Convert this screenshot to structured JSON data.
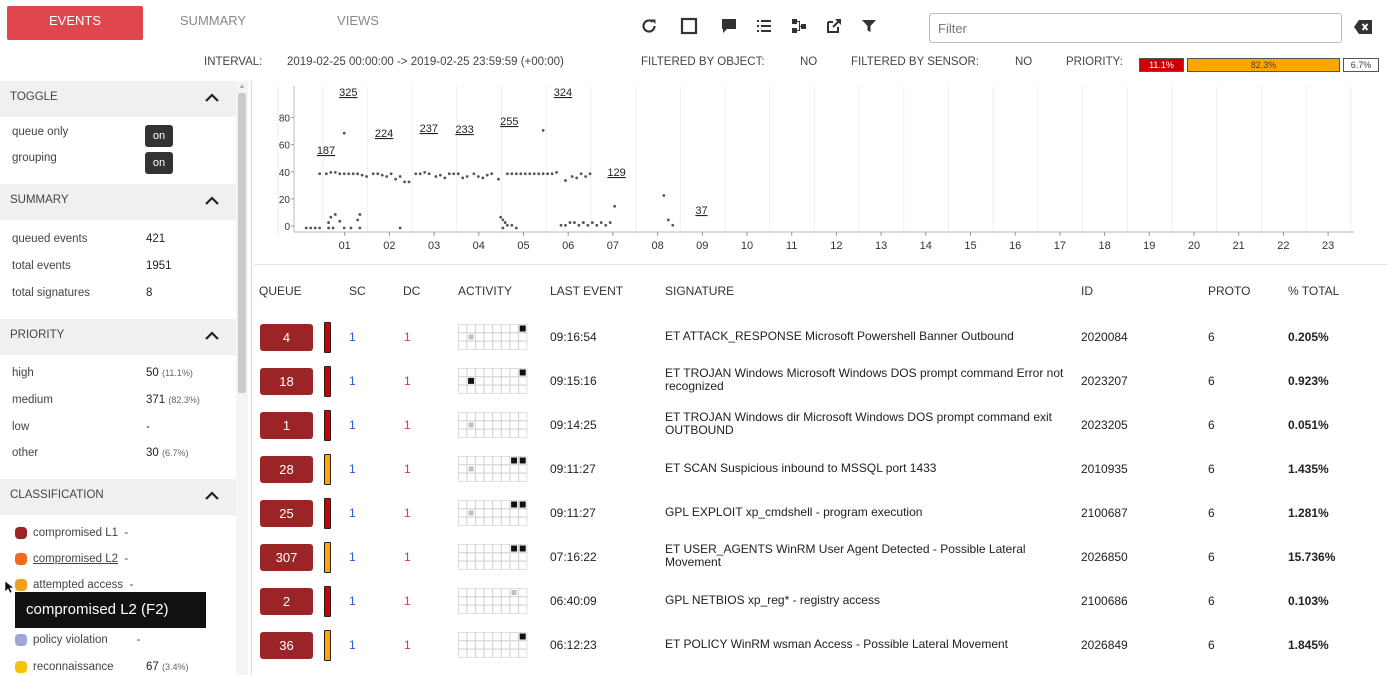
{
  "tabs": [
    {
      "label": "EVENTS",
      "active": true
    },
    {
      "label": "SUMMARY",
      "active": false
    },
    {
      "label": "VIEWS",
      "active": false
    }
  ],
  "toolbar_icons": [
    "refresh-icon",
    "fullscreen-icon",
    "comment-icon",
    "list-icon",
    "graph-icon",
    "external-link-icon",
    "filter-icon"
  ],
  "filter": {
    "placeholder": "Filter",
    "value": ""
  },
  "info": {
    "interval_label": "INTERVAL:",
    "interval_value": "2019-02-25 00:00:00 -> 2019-02-25 23:59:59 (+00:00)",
    "by_object_label": "FILTERED BY OBJECT:",
    "by_object_value": "NO",
    "by_sensor_label": "FILTERED BY SENSOR:",
    "by_sensor_value": "NO",
    "priority_label": "PRIORITY:",
    "priority_bars": [
      {
        "label": "11.1%",
        "fraction": 0.111,
        "color": "#cc0000"
      },
      {
        "label": "82.3%",
        "fraction": 0.823,
        "color": "#ffa500"
      },
      {
        "label": "6.7%",
        "fraction": 0.067,
        "color": "#ffffff"
      }
    ]
  },
  "sidebar": {
    "toggle": {
      "title": "TOGGLE",
      "items": [
        {
          "label": "queue only",
          "state": "on"
        },
        {
          "label": "grouping",
          "state": "on"
        }
      ]
    },
    "summary": {
      "title": "SUMMARY",
      "items": [
        {
          "label": "queued events",
          "value": "421"
        },
        {
          "label": "total events",
          "value": "1951"
        },
        {
          "label": "total signatures",
          "value": "8"
        }
      ]
    },
    "priority": {
      "title": "PRIORITY",
      "items": [
        {
          "label": "high",
          "value": "50",
          "pct": "(11.1%)"
        },
        {
          "label": "medium",
          "value": "371",
          "pct": "(82.3%)"
        },
        {
          "label": "low",
          "value": "-",
          "pct": ""
        },
        {
          "label": "other",
          "value": "30",
          "pct": "(6.7%)"
        }
      ]
    },
    "classification": {
      "title": "CLASSIFICATION",
      "items": [
        {
          "label": "compromised L1",
          "value": "-",
          "color": "#9b2426",
          "link": false
        },
        {
          "label": "compromised L2",
          "value": "-",
          "color": "#f26a1b",
          "link": true
        },
        {
          "label": "attempted access",
          "value": "-",
          "color": "#f2a01b",
          "link": false
        },
        {
          "label": "policy violation",
          "value": "-",
          "color": "#9ea8d8",
          "link": false
        },
        {
          "label": "reconnaissance",
          "value": "67",
          "pct": "(3.4%)",
          "color": "#f5c400",
          "link": false
        }
      ]
    },
    "tooltip": "compromised L2 (F2)"
  },
  "chart_data": {
    "type": "scatter",
    "x_ticks": [
      "01",
      "02",
      "03",
      "04",
      "05",
      "06",
      "07",
      "08",
      "09",
      "10",
      "11",
      "12",
      "13",
      "14",
      "15",
      "16",
      "17",
      "18",
      "19",
      "20",
      "21",
      "22",
      "23"
    ],
    "y_ticks": [
      "0",
      "20",
      "40",
      "60",
      "80"
    ],
    "ylim": [
      0,
      90
    ],
    "hour_totals": [
      {
        "hour": 0,
        "label": "187"
      },
      {
        "hour": 0.5,
        "label": "325"
      },
      {
        "hour": 1.3,
        "label": "224"
      },
      {
        "hour": 2.3,
        "label": "237"
      },
      {
        "hour": 3.1,
        "label": "233"
      },
      {
        "hour": 4.1,
        "label": "255"
      },
      {
        "hour": 5.3,
        "label": "324"
      },
      {
        "hour": 6.5,
        "label": "129"
      },
      {
        "hour": 8.4,
        "label": "37"
      }
    ],
    "points": [
      [
        0.05,
        0
      ],
      [
        0.15,
        0
      ],
      [
        0.25,
        0
      ],
      [
        0.35,
        0
      ],
      [
        0.55,
        0
      ],
      [
        0.65,
        0
      ],
      [
        0.9,
        0
      ],
      [
        1.05,
        0
      ],
      [
        1.25,
        0
      ],
      [
        2.15,
        0
      ],
      [
        4.45,
        0
      ],
      [
        4.75,
        0
      ],
      [
        0.35,
        40
      ],
      [
        0.5,
        40
      ],
      [
        0.6,
        41
      ],
      [
        0.7,
        41
      ],
      [
        0.8,
        40
      ],
      [
        0.9,
        40
      ],
      [
        1.0,
        40
      ],
      [
        1.1,
        40
      ],
      [
        1.2,
        40
      ],
      [
        1.3,
        39
      ],
      [
        1.4,
        38
      ],
      [
        1.55,
        40
      ],
      [
        1.65,
        40
      ],
      [
        1.75,
        39
      ],
      [
        1.85,
        38
      ],
      [
        1.95,
        40
      ],
      [
        2.05,
        36
      ],
      [
        2.15,
        38
      ],
      [
        2.25,
        34
      ],
      [
        2.35,
        34
      ],
      [
        2.5,
        40
      ],
      [
        2.6,
        40
      ],
      [
        2.7,
        41
      ],
      [
        2.8,
        40
      ],
      [
        2.95,
        38
      ],
      [
        3.05,
        39
      ],
      [
        3.15,
        37
      ],
      [
        3.25,
        40
      ],
      [
        3.35,
        40
      ],
      [
        3.45,
        40
      ],
      [
        3.55,
        37
      ],
      [
        3.65,
        38
      ],
      [
        3.8,
        40
      ],
      [
        3.9,
        38
      ],
      [
        4.0,
        37
      ],
      [
        4.1,
        39
      ],
      [
        4.2,
        40
      ],
      [
        4.35,
        36
      ],
      [
        4.55,
        40
      ],
      [
        4.65,
        40
      ],
      [
        4.75,
        40
      ],
      [
        4.85,
        40
      ],
      [
        4.95,
        40
      ],
      [
        5.05,
        40
      ],
      [
        5.15,
        40
      ],
      [
        5.25,
        40
      ],
      [
        5.35,
        40
      ],
      [
        5.45,
        40
      ],
      [
        5.55,
        40
      ],
      [
        5.65,
        41
      ],
      [
        5.85,
        35
      ],
      [
        6.0,
        38
      ],
      [
        6.1,
        37
      ],
      [
        6.2,
        40
      ],
      [
        6.3,
        38
      ],
      [
        6.4,
        40
      ],
      [
        0.9,
        70
      ],
      [
        5.35,
        72
      ],
      [
        0.55,
        4
      ],
      [
        0.6,
        8
      ],
      [
        0.7,
        10
      ],
      [
        0.8,
        5
      ],
      [
        1.2,
        6
      ],
      [
        1.25,
        10
      ],
      [
        4.4,
        8
      ],
      [
        4.45,
        6
      ],
      [
        4.5,
        4
      ],
      [
        4.55,
        2
      ],
      [
        4.65,
        2
      ],
      [
        5.75,
        2
      ],
      [
        5.85,
        2
      ],
      [
        5.95,
        4
      ],
      [
        6.05,
        4
      ],
      [
        6.15,
        2
      ],
      [
        6.25,
        4
      ],
      [
        6.35,
        2
      ],
      [
        6.45,
        4
      ],
      [
        6.55,
        2
      ],
      [
        6.65,
        4
      ],
      [
        6.75,
        2
      ],
      [
        6.85,
        4
      ],
      [
        6.95,
        16
      ],
      [
        8.05,
        24
      ],
      [
        8.15,
        6
      ],
      [
        8.25,
        2
      ]
    ]
  },
  "table": {
    "headers": [
      "QUEUE",
      "SC",
      "DC",
      "ACTIVITY",
      "LAST EVENT",
      "SIGNATURE",
      "ID",
      "PROTO",
      "% TOTAL"
    ],
    "rows": [
      {
        "queue": "4",
        "prio": "#cc0000",
        "sc": "1",
        "dc": "1",
        "activity": {
          "light": [
            8
          ],
          "dark": [
            3
          ]
        },
        "last": "09:16:54",
        "sig": "ET ATTACK_RESPONSE Microsoft Powershell Banner Outbound",
        "id": "2020084",
        "proto": "6",
        "pct": "0.205%"
      },
      {
        "queue": "18",
        "prio": "#cc0000",
        "sc": "1",
        "dc": "1",
        "activity": {
          "light": [],
          "dark": [
            8,
            3
          ]
        },
        "last": "09:15:16",
        "sig": "ET TROJAN Windows Microsoft Windows DOS prompt command Error not recognized",
        "id": "2023207",
        "proto": "6",
        "pct": "0.923%"
      },
      {
        "queue": "1",
        "prio": "#cc0000",
        "sc": "1",
        "dc": "1",
        "activity": {
          "light": [
            8
          ],
          "dark": []
        },
        "last": "09:14:25",
        "sig": "ET TROJAN Windows dir Microsoft Windows DOS prompt command exit OUTBOUND",
        "id": "2023205",
        "proto": "6",
        "pct": "0.051%"
      },
      {
        "queue": "28",
        "prio": "#ffa500",
        "sc": "1",
        "dc": "1",
        "activity": {
          "light": [
            8
          ],
          "dark": [
            2,
            3
          ]
        },
        "last": "09:11:27",
        "sig": "ET SCAN Suspicious inbound to MSSQL port 1433",
        "id": "2010935",
        "proto": "6",
        "pct": "1.435%"
      },
      {
        "queue": "25",
        "prio": "#cc0000",
        "sc": "1",
        "dc": "1",
        "activity": {
          "light": [
            8
          ],
          "dark": [
            2,
            3
          ]
        },
        "last": "09:11:27",
        "sig": "GPL EXPLOIT xp_cmdshell - program execution",
        "id": "2100687",
        "proto": "6",
        "pct": "1.281%"
      },
      {
        "queue": "307",
        "prio": "#ffa500",
        "sc": "1",
        "dc": "1",
        "activity": {
          "light": [],
          "dark": [
            2,
            3
          ]
        },
        "last": "07:16:22",
        "sig": "ET USER_AGENTS WinRM User Agent Detected - Possible Lateral Movement",
        "id": "2026850",
        "proto": "6",
        "pct": "15.736%"
      },
      {
        "queue": "2",
        "prio": "#cc0000",
        "sc": "1",
        "dc": "1",
        "activity": {
          "light": [
            3
          ],
          "dark": []
        },
        "last": "06:40:09",
        "sig": "GPL NETBIOS xp_reg* - registry access",
        "id": "2100686",
        "proto": "6",
        "pct": "0.103%"
      },
      {
        "queue": "36",
        "prio": "#ffa500",
        "sc": "1",
        "dc": "1",
        "activity": {
          "light": [],
          "dark": [
            3
          ]
        },
        "last": "06:12:23",
        "sig": "ET POLICY WinRM wsman Access - Possible Lateral Movement",
        "id": "2026849",
        "proto": "6",
        "pct": "1.845%"
      }
    ]
  }
}
